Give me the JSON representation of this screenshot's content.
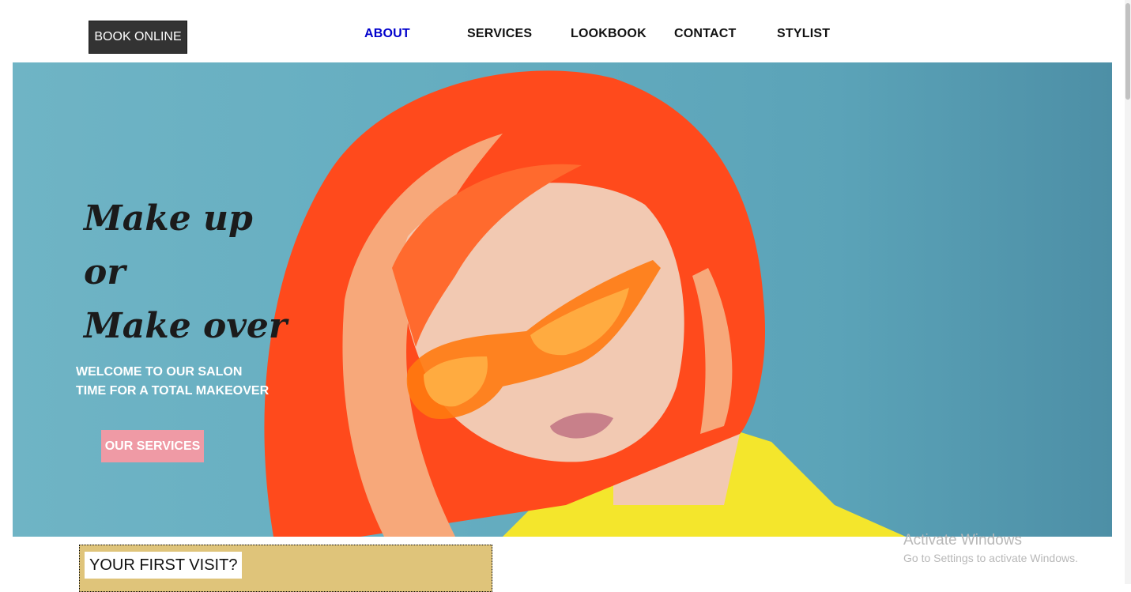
{
  "header": {
    "book_online": "BOOK ONLINE",
    "nav": [
      "ABOUT",
      "SERVICES",
      "LOOKBOOK",
      "CONTACT",
      "STYLIST"
    ]
  },
  "hero": {
    "headline": [
      "Make up",
      "or",
      "Make over"
    ],
    "welcome_line1": "WELCOME TO OUR SALON",
    "welcome_line2": "TIME FOR A TOTAL MAKEOVER",
    "cta": "OUR SERVICES"
  },
  "first_visit": {
    "label": "YOUR FIRST VISIT?"
  },
  "watermark": {
    "title": "Activate Windows",
    "subtitle": "Go to Settings to activate Windows."
  },
  "colors": {
    "active_nav": "#0000cc",
    "hero_bg": "#65adc0",
    "cta_bg": "#ef9aa5",
    "first_visit_bg": "#dfc47a",
    "hair": "#ff4a1c"
  }
}
